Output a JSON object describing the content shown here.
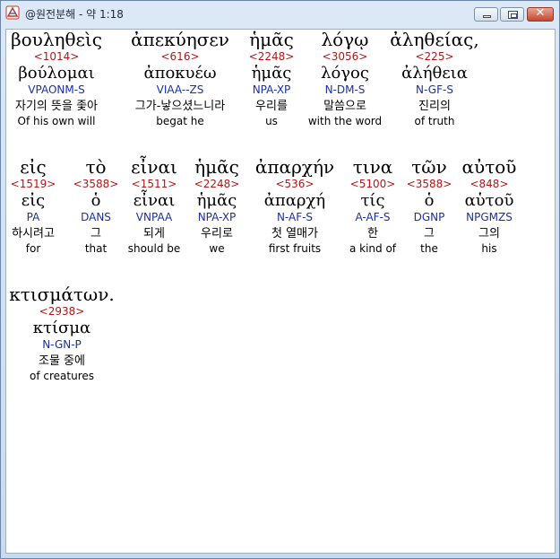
{
  "window": {
    "title": "@원전분해 - 약 1:18",
    "accent": "#c9dbee",
    "strong_color": "#b01818",
    "parse_color": "#1a30a6",
    "highlight_color": "#ffffff"
  },
  "words": [
    {
      "greek": "βουληθεὶς",
      "strong": "<1014>",
      "lemma": "βούλομαι",
      "parse": "VPAONM-S",
      "korean": "자기의 뜻을 좇아",
      "english": "Of his own will"
    },
    {
      "greek": "ἀπεκύησεν",
      "strong": "<616>",
      "lemma": "ἀποκυέω",
      "parse": "VIAA--ZS",
      "korean": "그가-낳으셨느니라",
      "english": "begat he"
    },
    {
      "greek": "ἡμᾶς",
      "strong": "<2248>",
      "lemma": "ἡμᾶς",
      "parse": "NPA-XP",
      "korean": "우리를",
      "english": "us"
    },
    {
      "greek": "λόγῳ",
      "strong": "<3056>",
      "lemma": "λόγος",
      "parse": "N-DM-S",
      "korean": "말씀으로",
      "english": "with the word"
    },
    {
      "greek": "ἀληθείας,",
      "strong": "<225>",
      "lemma": "ἀλήθεια",
      "parse": "N-GF-S",
      "korean": "진리의",
      "english": "of truth"
    },
    {
      "greek": "εἰς",
      "strong": "<1519>",
      "lemma": "εἰς",
      "parse": "PA",
      "korean": "하시려고",
      "english": "for"
    },
    {
      "greek": "τὸ",
      "strong": "<3588>",
      "lemma": "ὁ",
      "parse": "DANS",
      "korean": "그",
      "english": "that"
    },
    {
      "greek": "εἶναι",
      "strong": "<1511>",
      "lemma": "εἶναι",
      "parse": "VNPAA",
      "korean": "되게",
      "english": "should be"
    },
    {
      "greek": "ἡμᾶς",
      "strong": "<2248>",
      "lemma": "ἡμᾶς",
      "parse": "NPA-XP",
      "korean": "우리로",
      "english": "we"
    },
    {
      "greek": "ἀπαρχήν",
      "strong": "<536>",
      "lemma": "ἀπαρχή",
      "parse": "N-AF-S",
      "korean": "첫 열매가",
      "english": "first fruits"
    },
    {
      "greek": "τινα",
      "strong": "<5100>",
      "lemma": "τίς",
      "parse": "A-AF-S",
      "korean": "한",
      "english": "a kind of"
    },
    {
      "greek": "τῶν",
      "strong": "<3588>",
      "lemma": "ὁ",
      "parse": "DGNP",
      "korean": "그",
      "english": "the"
    },
    {
      "greek": "αὐτοῦ",
      "strong": "<848>",
      "lemma": "αὑτοῦ",
      "parse": "NPGMZS",
      "korean": "그의",
      "english": "his"
    },
    {
      "greek": "κτισμάτων.",
      "strong": "<2938>",
      "lemma": "κτίσμα",
      "parse": "N-GN-P",
      "korean": "조물 중에",
      "english": "of creatures"
    }
  ]
}
